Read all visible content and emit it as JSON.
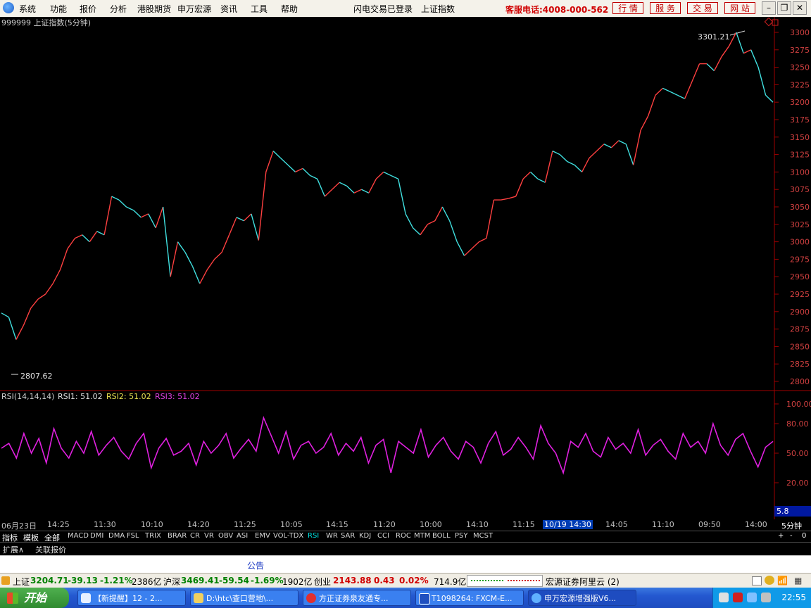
{
  "menubar": {
    "items": [
      "系统",
      "功能",
      "报价",
      "分析",
      "港股期货",
      "申万宏源",
      "资讯",
      "工具",
      "帮助"
    ],
    "status_login": "闪电交易已登录",
    "status_index": "上证指数",
    "hotline": "客服电话:4008-000-562",
    "buttons": [
      "行 情",
      "服 务",
      "交 易",
      "网 站"
    ]
  },
  "chart": {
    "header": "999999 上证指数(5分钟)",
    "high_label": "3301.21",
    "low_label": "2807.62",
    "price_ticks": [
      "3300",
      "3275",
      "3250",
      "3225",
      "3200",
      "3175",
      "3150",
      "3125",
      "3100",
      "3075",
      "3050",
      "3025",
      "3000",
      "2975",
      "2950",
      "2925",
      "2900",
      "2875",
      "2850",
      "2825",
      "2800"
    ],
    "rsi_header": {
      "name": "RSI(14,14,14)",
      "rsi1": "RSI1: 51.02",
      "rsi2": "RSI2: 51.02",
      "rsi3": "RSI3: 51.02"
    },
    "rsi_ticks": [
      "100.00",
      "80.00",
      "50.00",
      "20.00"
    ],
    "rsi_value_box": "5.8"
  },
  "time_axis": {
    "ticks": [
      "06月23日",
      "14:25",
      "11:30",
      "10:10",
      "14:20",
      "11:25",
      "10:05",
      "14:15",
      "11:20",
      "10:00",
      "14:10",
      "11:15",
      "10/19 14:30",
      "14:05",
      "11:10",
      "09:50",
      "14:00"
    ],
    "period": "5分钟",
    "right_controls": [
      "+",
      "-",
      "0"
    ]
  },
  "indicator_bar": {
    "tabs": [
      "指标",
      "模板",
      "全部"
    ],
    "items": [
      "MACD",
      "DMI",
      "DMA",
      "FSL",
      "TRIX",
      "BRAR",
      "CR",
      "VR",
      "OBV",
      "ASI",
      "EMV",
      "VOL-TDX",
      "RSI",
      "WR",
      "SAR",
      "KDJ",
      "CCI",
      "ROC",
      "MTM",
      "BOLL",
      "PSY",
      "MCST"
    ],
    "active": "RSI"
  },
  "ext_bar": {
    "expand": "扩展∧",
    "related": "关联报价"
  },
  "notice": {
    "label": "公告"
  },
  "status_bar": {
    "sh_name": "上证",
    "sh_value": "3204.71",
    "sh_change": "-39.13",
    "sh_pct": "-1.21%",
    "sh_amount": "2386亿",
    "hs_name": "沪深",
    "hs_value": "3469.41",
    "hs_change": "-59.54",
    "hs_pct": "-1.69%",
    "hs_amount": "1902亿",
    "cy_name": "创业",
    "cy_value": "2143.88",
    "cy_change": "0.43",
    "cy_pct": "0.02%",
    "cy_amount": "714.9亿",
    "server": "宏源证券阿里云 (2)"
  },
  "taskbar": {
    "start": "开始",
    "tasks": [
      "【新提醒】12 - 2...",
      "D:\\htc\\查口营地\\...",
      "方正证券泉友通专...",
      "T1098264: FXCM-E...",
      "申万宏源增强版V6..."
    ],
    "clock": "22:55"
  },
  "chart_data": {
    "type": "line",
    "title": "999999 上证指数(5分钟)",
    "y_range": [
      2800,
      3300
    ],
    "max": 3301.21,
    "min": 2807.62,
    "series": [
      {
        "name": "上证指数",
        "values": [
          2898,
          2892,
          2860,
          2880,
          2905,
          2918,
          2925,
          2940,
          2960,
          2990,
          3005,
          3010,
          3000,
          3015,
          3010,
          3065,
          3060,
          3050,
          3045,
          3035,
          3040,
          3020,
          3050,
          2950,
          3000,
          2985,
          2965,
          2940,
          2960,
          2975,
          2985,
          3010,
          3035,
          3030,
          3040,
          3002,
          3100,
          3130,
          3120,
          3110,
          3100,
          3105,
          3095,
          3090,
          3065,
          3075,
          3085,
          3080,
          3070,
          3075,
          3070,
          3090,
          3100,
          3095,
          3090,
          3040,
          3020,
          3010,
          3025,
          3030,
          3050,
          3030,
          3000,
          2980,
          2990,
          3000,
          3005,
          3060,
          3060,
          3062,
          3065,
          3090,
          3100,
          3090,
          3085,
          3130,
          3125,
          3115,
          3110,
          3100,
          3120,
          3130,
          3140,
          3135,
          3145,
          3140,
          3110,
          3160,
          3180,
          3210,
          3220,
          3215,
          3210,
          3205,
          3230,
          3255,
          3255,
          3245,
          3265,
          3280,
          3300,
          3270,
          3275,
          3250,
          3210,
          3200
        ]
      },
      {
        "name": "RSI",
        "values": [
          55,
          60,
          45,
          70,
          50,
          65,
          40,
          75,
          55,
          45,
          62,
          50,
          72,
          48,
          58,
          66,
          52,
          44,
          60,
          70,
          35,
          55,
          65,
          48,
          52,
          60,
          38,
          62,
          50,
          58,
          70,
          45,
          55,
          64,
          52,
          86,
          68,
          50,
          72,
          44,
          58,
          62,
          50,
          56,
          70,
          48,
          60,
          52,
          66,
          40,
          58,
          64,
          30,
          62,
          56,
          50,
          74,
          46,
          58,
          66,
          52,
          44,
          62,
          56,
          40,
          60,
          72,
          48,
          54,
          66,
          56,
          44,
          78,
          60,
          50,
          30,
          62,
          56,
          70,
          52,
          46,
          66,
          54,
          60,
          50,
          74,
          48,
          58,
          64,
          52,
          44,
          70,
          56,
          62,
          50,
          80,
          58,
          48,
          64,
          70,
          52,
          36,
          56,
          62
        ]
      }
    ]
  }
}
